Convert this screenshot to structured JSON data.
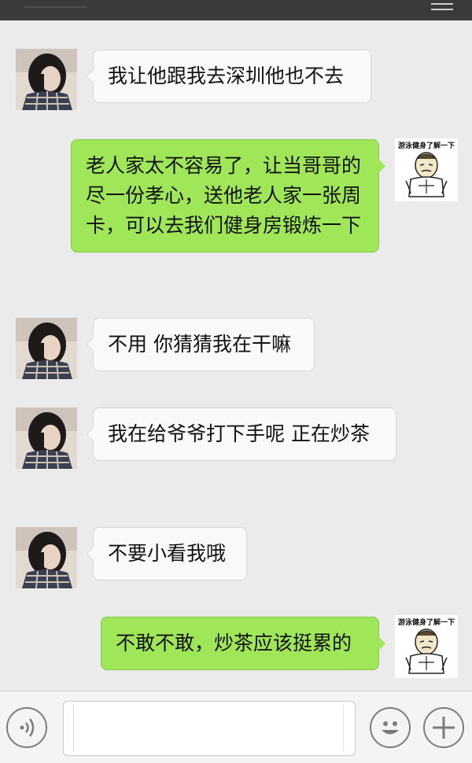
{
  "colors": {
    "incoming_bubble": "#f9f9f9",
    "outgoing_bubble": "#9fe658",
    "chat_background": "#ebebeb",
    "status_bar": "#3a3a3a"
  },
  "sticker": {
    "caption": "游泳健身了解一下",
    "icon": "meme-face-muscle-icon"
  },
  "messages": [
    {
      "sender": "other",
      "text": "我让他跟我去深圳他也不去"
    },
    {
      "sender": "self",
      "text": "老人家太不容易了，让当哥哥的尽一份孝心，送他老人家一张周卡，可以去我们健身房锻炼一下"
    },
    {
      "sender": "other",
      "text": "不用 你猜猜我在干嘛"
    },
    {
      "sender": "other",
      "text": "我在给爷爷打下手呢 正在炒茶"
    },
    {
      "sender": "other",
      "text": "不要小看我哦"
    },
    {
      "sender": "self",
      "text": "不敢不敢，炒茶应该挺累的"
    }
  ],
  "input_bar": {
    "text_value": "",
    "voice_icon": "voice-icon",
    "emoji_icon": "emoji-icon",
    "plus_icon": "plus-icon"
  }
}
